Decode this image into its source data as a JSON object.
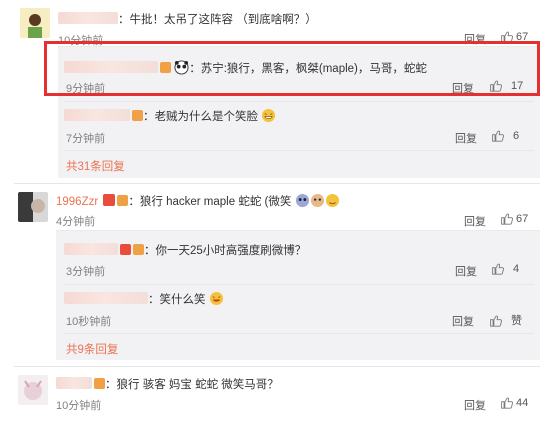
{
  "comments": [
    {
      "text": "：牛批！太吊了这阵容 （到底啥啊？）",
      "time": "10分钟前",
      "reply": "回复",
      "likes": "67"
    },
    {
      "text": "：苏宁:狼行，黑客，枫桀(maple)，马哥，蛇蛇",
      "time": "9分钟前",
      "reply": "回复",
      "likes": "17"
    },
    {
      "text": "：老贼为什么是个笑脸",
      "time": "7分钟前",
      "reply": "回复",
      "likes": "6"
    },
    {
      "more": "共31条回复"
    },
    {
      "name": "1996Zzr",
      "text": "：狼行 hacker maple 蛇蛇 (微笑",
      "time": "4分钟前",
      "reply": "回复",
      "likes": "67"
    },
    {
      "text": "：你一天25小时高强度刷微博？",
      "time": "3分钟前",
      "reply": "回复",
      "likes": "4"
    },
    {
      "text": "：笑什么笑",
      "time": "10秒钟前",
      "reply": "回复",
      "likes": "赞"
    },
    {
      "more": "共9条回复"
    },
    {
      "text": "：狼行 骇客 妈宝 蛇蛇 微笑马哥？",
      "time": "10分钟前",
      "reply": "回复",
      "likes": "44"
    }
  ],
  "colors": {
    "accent": "#eb7350",
    "highlight": "#e43030"
  },
  "icons": [
    "thumbs-up-icon",
    "grin-emoji-icon",
    "panda-emoji-icon",
    "v-badge-icon"
  ]
}
